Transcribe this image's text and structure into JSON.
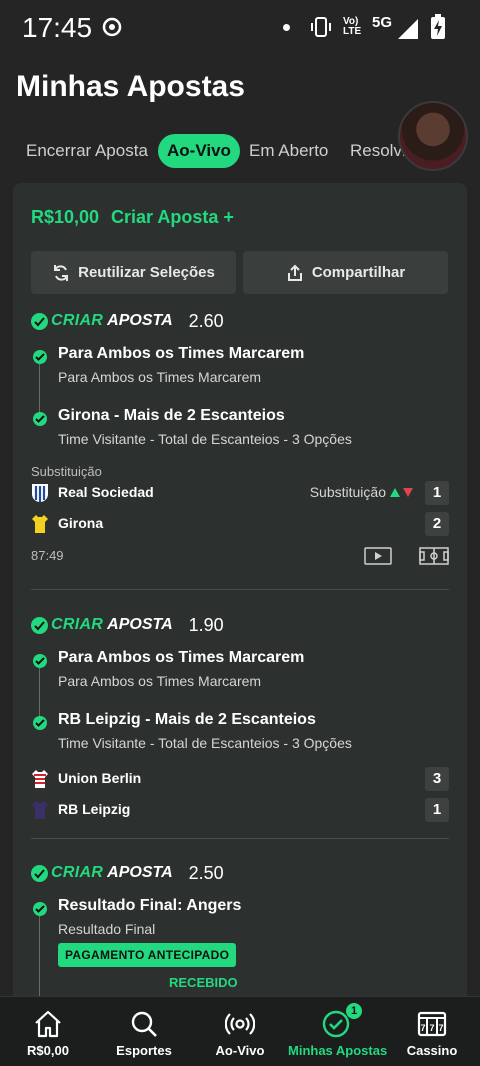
{
  "status_bar": {
    "time": "17:45",
    "volte": "Vo) LTE",
    "network": "5G"
  },
  "page": {
    "title": "Minhas Apostas"
  },
  "tabs": [
    {
      "label": "Encerrar Aposta"
    },
    {
      "label": "Ao-Vivo",
      "active": true
    },
    {
      "label": "Em Aberto"
    },
    {
      "label": "Resolvi"
    }
  ],
  "card": {
    "stake": "R$10,00",
    "create_bet": "Criar Aposta +",
    "reuse_button": "Reutilizar Seleções",
    "share_button": "Compartilhar"
  },
  "bets": [
    {
      "brand_criar": "CRIAR",
      "brand_aposta": "APOSTA",
      "odds": "2.60",
      "selections": [
        {
          "title": "Para Ambos os Times Marcarem",
          "subtitle": "Para Ambos os Times Marcarem"
        },
        {
          "title": "Girona - Mais de 2 Escanteios",
          "subtitle": "Time Visitante - Total de Escanteios - 3 Opções"
        }
      ],
      "substitution_label": "Substituição",
      "teams": [
        {
          "name": "Real Sociedad",
          "score": "1",
          "note": "Substituição"
        },
        {
          "name": "Girona",
          "score": "2"
        }
      ],
      "clock": "87:49"
    },
    {
      "brand_criar": "CRIAR",
      "brand_aposta": "APOSTA",
      "odds": "1.90",
      "selections": [
        {
          "title": "Para Ambos os Times Marcarem",
          "subtitle": "Para Ambos os Times Marcarem"
        },
        {
          "title": "RB Leipzig - Mais de 2 Escanteios",
          "subtitle": "Time Visitante - Total de Escanteios - 3 Opções"
        }
      ],
      "teams": [
        {
          "name": "Union Berlin",
          "score": "3"
        },
        {
          "name": "RB Leipzig",
          "score": "1"
        }
      ]
    },
    {
      "brand_criar": "CRIAR",
      "brand_aposta": "APOSTA",
      "odds": "2.50",
      "selections": [
        {
          "title": "Resultado Final: Angers",
          "subtitle": "Resultado Final"
        }
      ],
      "early_payout": "PAGAMENTO ANTECIPADO",
      "received": "RECEBIDO"
    }
  ],
  "bottom_nav": [
    {
      "label": "R$0,00",
      "icon": "home-icon"
    },
    {
      "label": "Esportes",
      "icon": "search-icon"
    },
    {
      "label": "Ao-Vivo",
      "icon": "live-icon"
    },
    {
      "label": "Minhas Apostas",
      "icon": "my-bets-icon",
      "active": true,
      "badge": "1"
    },
    {
      "label": "Cassino",
      "icon": "slot-machine-icon"
    }
  ],
  "colors": {
    "accent": "#23d97f",
    "background": "#252525",
    "card": "#2c302e",
    "negative": "#e0454f"
  }
}
